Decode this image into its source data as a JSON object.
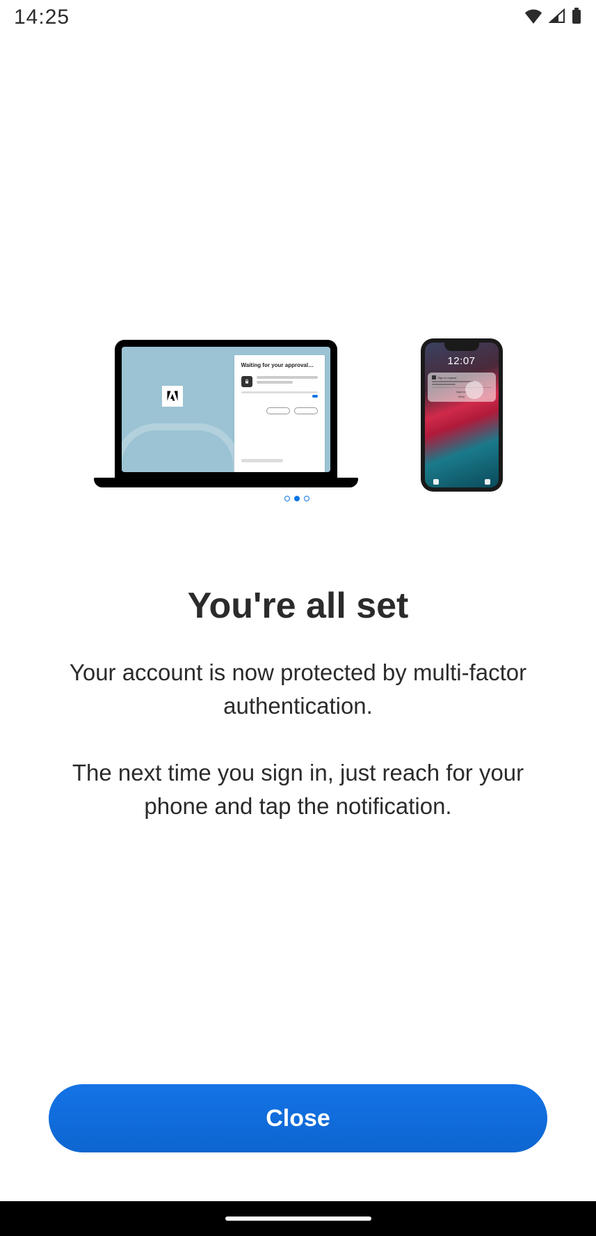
{
  "status_bar": {
    "time": "14:25"
  },
  "illustration": {
    "laptop_card_title": "Waiting for your approval…",
    "phone_time": "12:07",
    "phone_date": "",
    "notif_approve": "Approve",
    "notif_deny": "Deny",
    "pager": {
      "total": 3,
      "active_index": 1
    }
  },
  "main": {
    "heading": "You're all set",
    "paragraph1": "Your account is now protected by multi-factor authentication.",
    "paragraph2": "The next time you sign in, just reach for your phone and tap the notification."
  },
  "actions": {
    "close_label": "Close"
  }
}
